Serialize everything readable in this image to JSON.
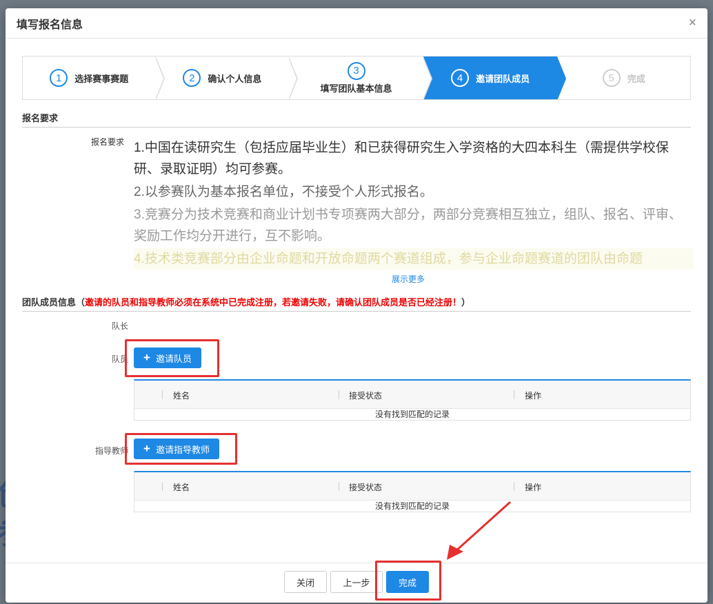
{
  "dialog": {
    "title": "填写报名信息",
    "close": "×"
  },
  "steps": [
    {
      "num": "1",
      "label": "选择赛事赛题"
    },
    {
      "num": "2",
      "label": "确认个人信息"
    },
    {
      "num": "3",
      "label": "填写团队基本信息"
    },
    {
      "num": "4",
      "label": "邀请团队成员"
    },
    {
      "num": "5",
      "label": "完成"
    }
  ],
  "requirements": {
    "section_title": "报名要求",
    "label": "报名要求",
    "lines": [
      "1.中国在读研究生（包括应届毕业生）和已获得研究生入学资格的大四本科生（需提供学校保研、录取证明）均可参赛。",
      "2.以参赛队为基本报名单位，不接受个人形式报名。",
      "3.竞赛分为技术竞赛和商业计划书专项赛两大部分，两部分竞赛相互独立，组队、报名、评审、奖励工作均分开进行，互不影响。",
      "4.技术类竞赛部分由企业命题和开放命题两个赛道组成，参与企业命题赛道的团队由命题"
    ],
    "show_more": "展示更多"
  },
  "team": {
    "section_title": "团队成员信息（",
    "warning": "邀请的队员和指导教师必须在系统中已完成注册，若邀请失败，请确认团队成员是否已经注册！",
    "section_close": "）",
    "leader_label": "队长",
    "member_label": "队员",
    "invite_member": "邀请队员",
    "advisor_label": "指导教师",
    "invite_advisor": "邀请指导教师",
    "plus_icon": "+",
    "table_headers": [
      "姓名",
      "接受状态",
      "操作"
    ],
    "empty_text": "没有找到匹配的记录"
  },
  "footer": {
    "close": "关闭",
    "prev": "上一步",
    "finish": "完成"
  },
  "colors": {
    "primary": "#1e88e5",
    "highlight": "#e53030",
    "warning": "#e00000"
  },
  "backdrop": {
    "chars": [
      "创",
      "参"
    ]
  }
}
